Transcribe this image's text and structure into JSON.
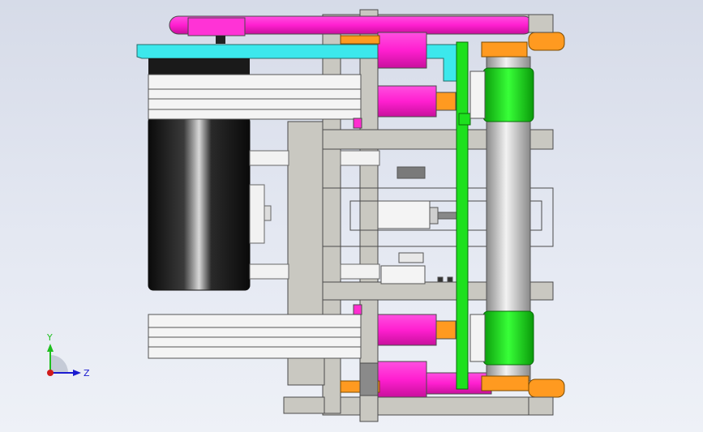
{
  "viewport": {
    "background_top": "#d6dbe8",
    "background_bottom": "#eef1f7"
  },
  "colors": {
    "magenta": "#ff2fd0",
    "magenta_dark": "#c8109c",
    "cyan": "#3ce8ec",
    "orange": "#ff9a20",
    "green": "#1ee01e",
    "green_dark": "#0a9a0a",
    "gray_plate": "#c9c8c1",
    "gray_outline": "#4a4a4a",
    "white_extrusion": "#f4f4f4",
    "black_motor": "#151515"
  },
  "triad": {
    "y_label": "Y",
    "z_label": "Z",
    "y_color": "#1fbf1f",
    "z_color": "#1b1bd0",
    "x_color": "#d01b1b"
  }
}
